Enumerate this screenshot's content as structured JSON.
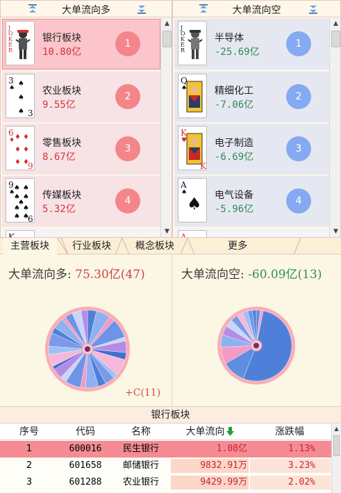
{
  "left_panel": {
    "title": "大单流向多",
    "items": [
      {
        "name": "银行板块",
        "value": "10.80亿",
        "rank": "1",
        "card": "JOKER",
        "selected": true
      },
      {
        "name": "农业板块",
        "value": "9.55亿",
        "rank": "2",
        "card": "3♠"
      },
      {
        "name": "零售板块",
        "value": "8.67亿",
        "rank": "3",
        "card": "6♦"
      },
      {
        "name": "传媒板块",
        "value": "5.32亿",
        "rank": "4",
        "card": "9♠"
      },
      {
        "name": "",
        "value": "",
        "rank": "",
        "card": "K"
      }
    ]
  },
  "right_panel": {
    "title": "大单流向空",
    "items": [
      {
        "name": "半导体",
        "value": "-25.69亿",
        "rank": "1",
        "card": "JOKER"
      },
      {
        "name": "精细化工",
        "value": "-7.06亿",
        "rank": "2",
        "card": "Q♠"
      },
      {
        "name": "电子制造",
        "value": "-6.69亿",
        "rank": "3",
        "card": "K♥"
      },
      {
        "name": "电气设备",
        "value": "-5.96亿",
        "rank": "4",
        "card": "A♠"
      },
      {
        "name": "",
        "value": "",
        "rank": "",
        "card": "A"
      }
    ]
  },
  "tabs": [
    "主营板块",
    "行业板块",
    "概念板块",
    "更多"
  ],
  "summary": {
    "left": {
      "label": "大单流向多:",
      "value": "75.30亿(47)",
      "more": "+C(11)"
    },
    "right": {
      "label": "大单流向空:",
      "value": "-60.09亿(13)"
    }
  },
  "colors": {
    "long": "#f4858a",
    "short": "#86aaf1",
    "positive_text": "#d4343f",
    "negative_text": "#2e8b57"
  },
  "table": {
    "title": "银行板块",
    "headers": {
      "index": "序号",
      "code": "代码",
      "name": "名称",
      "flow": "大单流向",
      "change": "涨跌幅"
    },
    "sort_icon": "arrow-down-icon",
    "rows": [
      {
        "index": "1",
        "code": "600016",
        "name": "民生银行",
        "flow": "1.08亿",
        "change": "1.13%"
      },
      {
        "index": "2",
        "code": "601658",
        "name": "邮储银行",
        "flow": "9832.91万",
        "change": "3.23%"
      },
      {
        "index": "3",
        "code": "601288",
        "name": "农业银行",
        "flow": "9429.99万",
        "change": "2.02%"
      }
    ]
  }
}
